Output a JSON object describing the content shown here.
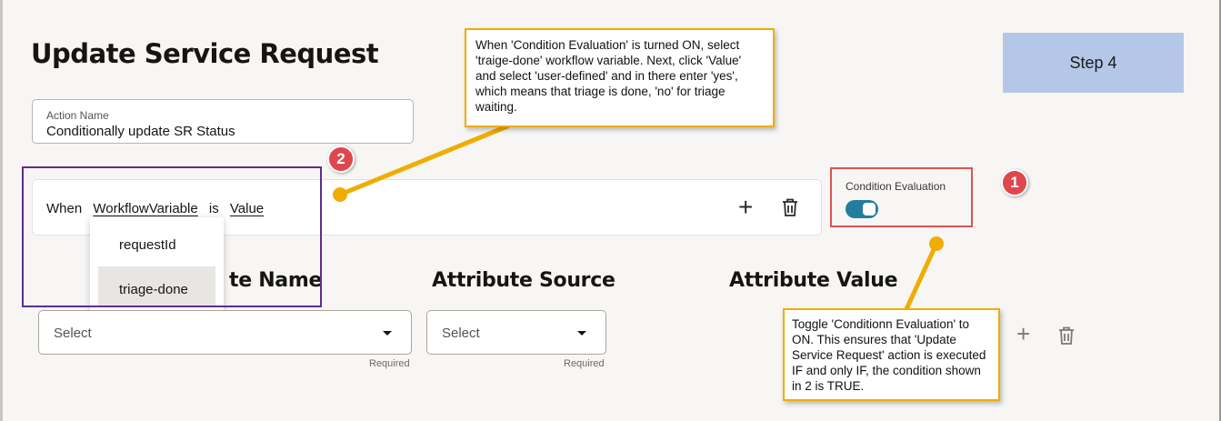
{
  "page": {
    "title": "Update Service Request"
  },
  "step": {
    "label": "Step 4"
  },
  "action_name": {
    "label": "Action Name",
    "value": "Conditionally update SR Status"
  },
  "condition": {
    "when": "When",
    "variable_type": "WorkflowVariable",
    "is": "is",
    "value_type": "Value",
    "add_icon": "plus-icon",
    "delete_icon": "trash-icon"
  },
  "variable_dropdown": {
    "options": [
      "requestId",
      "triage-done"
    ],
    "highlighted": "triage-done"
  },
  "attributes": {
    "name_header": "te Name",
    "source_header": "Attribute Source",
    "value_header": "Attribute Value",
    "name_select": {
      "placeholder": "Select",
      "hint": "Required"
    },
    "source_select": {
      "placeholder": "Select",
      "hint": "Required"
    }
  },
  "condition_evaluation": {
    "label": "Condition Evaluation",
    "on": true
  },
  "annotations": {
    "badge_1": "1",
    "badge_2": "2",
    "callout_top": "When 'Condition Evaluation' is turned ON, select 'traige-done' workflow variable. Next, click 'Value' and select 'user-defined' and in there enter 'yes', which means that triage is done, 'no' for triage waiting.",
    "callout_bottom": "Toggle 'Conditionn Evaluation' to ON. This ensures that 'Update Service Request' action is executed IF and only IF, the condition shown in 2 is TRUE."
  },
  "colors": {
    "toggle_on": "#227e9e",
    "callout_border": "#f0ad00",
    "badge": "#e0474c",
    "highlight_box_purple": "#5e2d91",
    "highlight_box_red": "#e05250",
    "step_box": "#b4c7e7"
  }
}
